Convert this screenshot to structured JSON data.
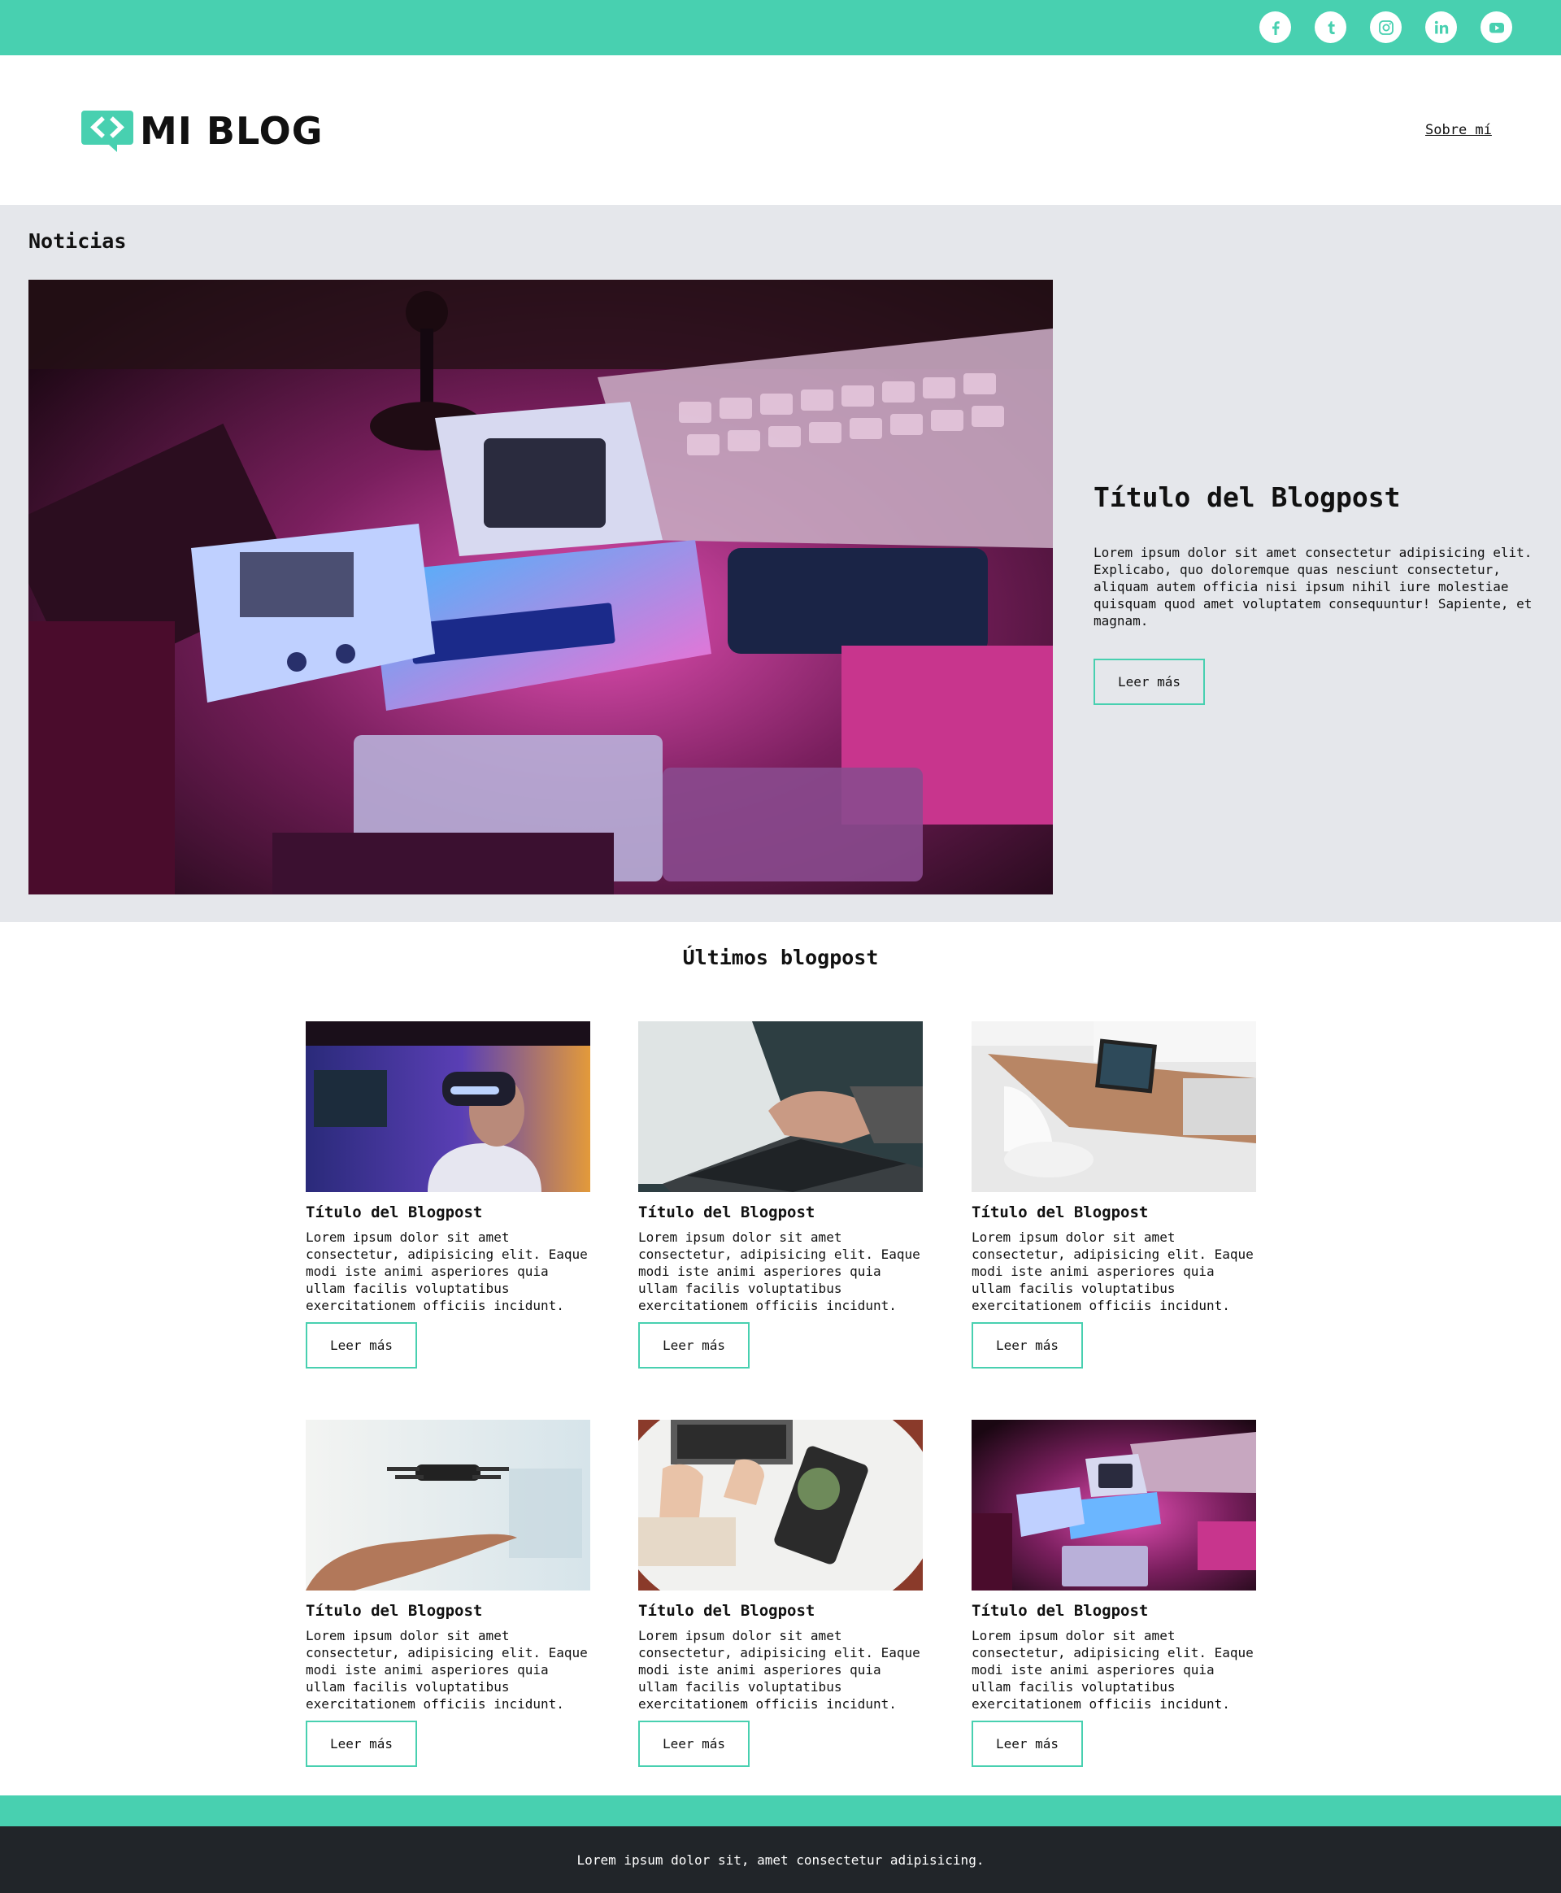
{
  "social": {
    "links": [
      {
        "name": "facebook",
        "icon": "facebook-icon"
      },
      {
        "name": "tumblr",
        "icon": "tumblr-icon"
      },
      {
        "name": "instagram",
        "icon": "instagram-icon"
      },
      {
        "name": "linkedin",
        "icon": "linkedin-icon"
      },
      {
        "name": "youtube",
        "icon": "youtube-icon"
      }
    ]
  },
  "header": {
    "logo_text": "MI BLOG",
    "nav_about": "Sobre mí"
  },
  "news": {
    "section_title": "Noticias",
    "post_title": "Título del Blogpost",
    "post_excerpt": "Lorem ipsum dolor sit amet consectetur adipisicing elit. Explicabo, quo doloremque quas nesciunt consectetur, aliquam autem officia nisi ipsum nihil iure molestiae quisquam quod amet voluptatem consequuntur! Sapiente, et magnam.",
    "read_more": "Leer más"
  },
  "latest": {
    "section_title": "Últimos blogpost",
    "posts": [
      {
        "title": "Título del Blogpost",
        "excerpt": "Lorem ipsum dolor sit amet consectetur, adipisicing elit. Eaque modi iste animi asperiores quia ullam facilis voluptatibus exercitationem officiis incidunt.",
        "read_more": "Leer más",
        "image": "vr-headset-photo"
      },
      {
        "title": "Título del Blogpost",
        "excerpt": "Lorem ipsum dolor sit amet consectetur, adipisicing elit. Eaque modi iste animi asperiores quia ullam facilis voluptatibus exercitationem officiis incidunt.",
        "read_more": "Leer más",
        "image": "laptop-typing-photo"
      },
      {
        "title": "Título del Blogpost",
        "excerpt": "Lorem ipsum dolor sit amet consectetur, adipisicing elit. Eaque modi iste animi asperiores quia ullam facilis voluptatibus exercitationem officiis incidunt.",
        "read_more": "Leer más",
        "image": "desk-laptop-photo"
      },
      {
        "title": "Título del Blogpost",
        "excerpt": "Lorem ipsum dolor sit amet consectetur, adipisicing elit. Eaque modi iste animi asperiores quia ullam facilis voluptatibus exercitationem officiis incidunt.",
        "read_more": "Leer más",
        "image": "drone-hand-photo"
      },
      {
        "title": "Título del Blogpost",
        "excerpt": "Lorem ipsum dolor sit amet consectetur, adipisicing elit. Eaque modi iste animi asperiores quia ullam facilis voluptatibus exercitationem officiis incidunt.",
        "read_more": "Leer más",
        "image": "keyboard-plant-photo"
      },
      {
        "title": "Título del Blogpost",
        "excerpt": "Lorem ipsum dolor sit amet consectetur, adipisicing elit. Eaque modi iste animi asperiores quia ullam facilis voluptatibus exercitationem officiis incidunt.",
        "read_more": "Leer más",
        "image": "retro-computers-photo"
      }
    ]
  },
  "footer": {
    "text": "Lorem ipsum dolor sit, amet consectetur adipisicing."
  },
  "colors": {
    "accent": "#48d0b0",
    "section_bg": "#e5e7eb",
    "footer_bg": "#212529"
  }
}
